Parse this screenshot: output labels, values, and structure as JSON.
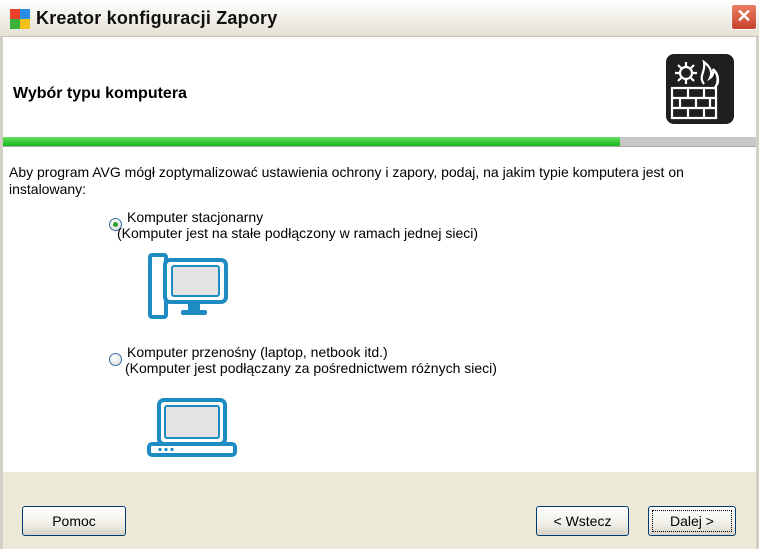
{
  "window": {
    "title": "Kreator konfiguracji Zapory",
    "close_symbol": "✕",
    "app_icon": "avg-multicolor-icon"
  },
  "header": {
    "title": "Wybór typu komputera",
    "icon": "firewall-gear-flame-icon"
  },
  "progress": {
    "fraction": 0.82,
    "color": "#2cc82c"
  },
  "content": {
    "description": "Aby program AVG mógł zoptymalizować ustawienia ochrony i zapory, podaj, na jakim typie komputera jest on instalowany:",
    "options": [
      {
        "label": "Komputer stacjonarny",
        "sublabel": "(Komputer jest na stałe podłączony w ramach jednej sieci)",
        "selected": true,
        "icon": "desktop-computer-icon"
      },
      {
        "label": "Komputer przenośny (laptop, netbook itd.)",
        "sublabel": "(Komputer jest podłączany za pośrednictwem różnych sieci)",
        "selected": false,
        "icon": "laptop-icon"
      }
    ]
  },
  "footer": {
    "help_label": "Pomoc",
    "back_label": "< Wstecz",
    "next_label": "Dalej >"
  },
  "colors": {
    "accent": "#1e8bc3",
    "progress": "#2cc82c",
    "radio_selected": "#30a030"
  }
}
